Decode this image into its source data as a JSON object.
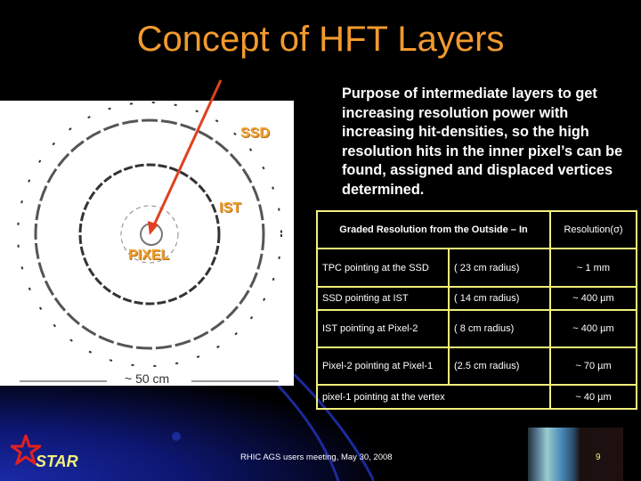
{
  "slide": {
    "title": "Concept of HFT Layers",
    "page_number": "9",
    "footer": "RHIC AGS users meeting, May 30, 2008",
    "logo_text": "STAR"
  },
  "diagram": {
    "labels": {
      "ssd": "SSD",
      "ist": "IST",
      "pixel": "PIXEL"
    },
    "scale": "~ 50 cm",
    "arrow_color": "#e04020",
    "label_color": "#f0a030"
  },
  "purpose": "Purpose of intermediate layers to get increasing resolution power with increasing hit-densities, so the high resolution hits in the inner pixel’s can be found, assigned and displaced vertices determined.",
  "table": {
    "headers": [
      "Graded Resolution from the Outside – In",
      "Resolution(σ)"
    ],
    "rows": [
      {
        "desc": "TPC pointing at the SSD",
        "radius": "( 23 cm radius)",
        "res": "~ 1 mm"
      },
      {
        "desc": "SSD pointing at  IST",
        "radius": "( 14 cm radius)",
        "res": "~ 400 µm"
      },
      {
        "desc": "IST pointing at Pixel-2",
        "radius": "( 8 cm radius)",
        "res": "~ 400 µm"
      },
      {
        "desc": "Pixel-2 pointing at Pixel-1",
        "radius": "(2.5 cm radius)",
        "res": "~ 70 µm"
      },
      {
        "desc": "pixel-1 pointing at the vertex",
        "radius": "",
        "res": "~ 40 µm"
      }
    ],
    "border_color": "#f2f07a"
  }
}
